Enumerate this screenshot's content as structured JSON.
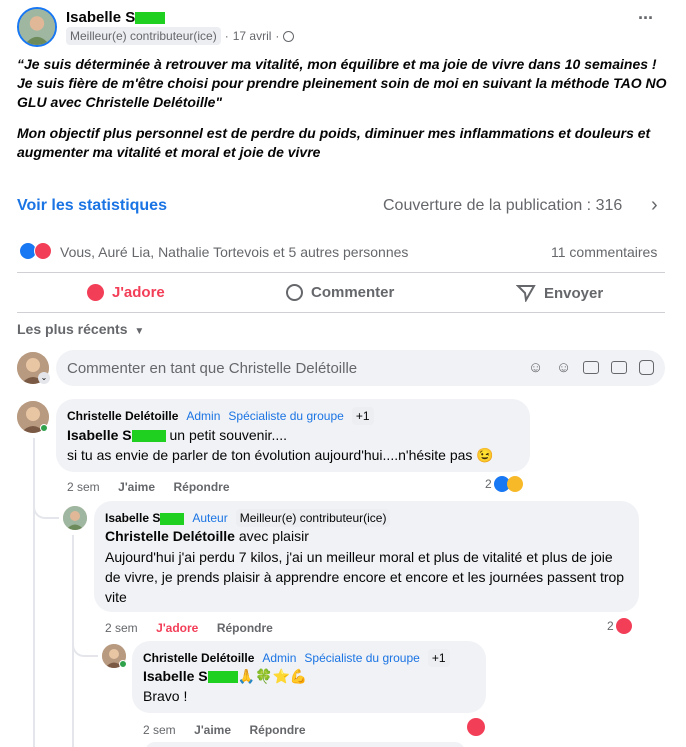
{
  "post": {
    "author": "Isabelle S",
    "badge": "Meilleur(e) contributeur(ice)",
    "sep": "·",
    "date": "17 avril",
    "privacy_sep": "·",
    "more": "···",
    "quote": "“Je suis déterminée à retrouver ma vitalité, mon équilibre et ma joie de vivre dans 10 semaines ! Je suis fière de m'être choisi pour prendre pleinement soin de moi en suivant la méthode TAO NO GLU avec Christelle Delétoille\"",
    "objective": "Mon objectif plus personnel est de perdre du poids, diminuer mes inflammations et douleurs et augmenter ma vitalité et moral et joie de vivre"
  },
  "stats": {
    "link": "Voir les statistiques",
    "coverage": "Couverture de la publication : 316",
    "reactions_text": "Vous, Auré Lia, Nathalie Tortevois et 5 autres personnes",
    "comments_count": "11 commentaires"
  },
  "actions": {
    "love": "J'adore",
    "comment": "Commenter",
    "send": "Envoyer"
  },
  "filter": {
    "label": "Les plus récents"
  },
  "composer": {
    "placeholder": "Commenter en tant que Christelle Delétoille"
  },
  "comments": [
    {
      "author": "Christelle Delétoille",
      "role1": "Admin",
      "role2": "Spécialiste du groupe",
      "plus": "+1",
      "mention": "Isabelle S",
      "line1": " un petit souvenir....",
      "line2": "si tu as envie de parler de ton évolution aujourd'hui....n'hésite pas 😉",
      "time": "2 sem",
      "like": "J'aime",
      "reply": "Répondre",
      "reaction_count": "2"
    },
    {
      "author": "Isabelle S",
      "role1": "Auteur",
      "badge": "Meilleur(e) contributeur(ice)",
      "mention": "Christelle Delétoille",
      "line1": " avec plaisir",
      "body": "Aujourd'hui j'ai perdu 7 kilos, j'ai un meilleur moral et plus de vitalité et plus de joie de vivre, je prends plaisir à apprendre encore et encore et les journées passent trop vite",
      "time": "2 sem",
      "like": "J'adore",
      "reply": "Répondre",
      "reaction_count": "2"
    },
    {
      "author": "Christelle Delétoille",
      "role1": "Admin",
      "role2": "Spécialiste du groupe",
      "plus": "+1",
      "mention": "Isabelle S",
      "emojis": "🙏🍀⭐💪",
      "line2": "Bravo !",
      "time": "2 sem",
      "like": "J'aime",
      "reply": "Répondre"
    }
  ]
}
